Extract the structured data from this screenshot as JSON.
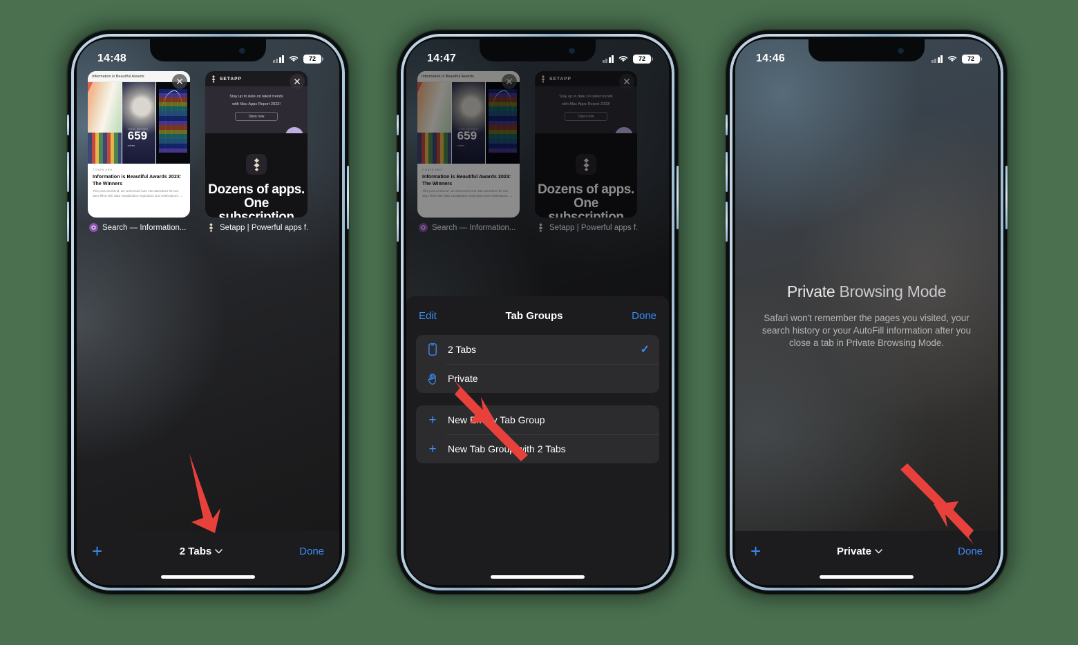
{
  "background_color": "#4a7050",
  "accent_color": "#3b8cf5",
  "arrow_color": "#e8413c",
  "phones": [
    {
      "id": "phone-tab-switcher",
      "status": {
        "time": "14:48",
        "battery": "72",
        "cellular_icon": "cellular-bars-icon",
        "wifi_icon": "wifi-icon",
        "battery_icon": "battery-icon"
      },
      "tabs": [
        {
          "title": "Search — Information...",
          "favicon": "information-is-beautiful-favicon",
          "close_label": "✕",
          "page": {
            "header": "Information is Beautiful Awards",
            "stat_number": "659",
            "stat_caption": "TOTAL ENTRIES",
            "stat_label": "entries",
            "ago": "7 DAYS AGO",
            "headline": "Information is Beautiful Awards 2023: The Winners",
            "body": "This post weekend, we welcomed over 150 attendees for two days filled with data visualization inspiration and celebrations.  →"
          }
        },
        {
          "title": "Setapp | Powerful apps f...",
          "favicon": "setapp-favicon",
          "close_label": "✕",
          "page": {
            "brand": "SETAPP",
            "promo_line1": "Stay up to date on latest trends",
            "promo_line2": "with Mac Apps Report 2023!",
            "promo_button": "Open now",
            "hero": "Dozens of apps. One subscription"
          }
        }
      ],
      "toolbar": {
        "new_tab_label": "+",
        "center_label": "2 Tabs",
        "chevron": "⌄",
        "done_label": "Done"
      },
      "arrow": {
        "name": "arrow-to-tab-group-selector",
        "direction": "down-right"
      }
    },
    {
      "id": "phone-tab-groups-sheet",
      "status": {
        "time": "14:47",
        "battery": "72"
      },
      "sheet": {
        "edit_label": "Edit",
        "title": "Tab Groups",
        "done_label": "Done",
        "groups": [
          {
            "rows": [
              {
                "icon": "iphone-icon",
                "label": "2 Tabs",
                "checked": true,
                "check_glyph": "✓"
              },
              {
                "icon": "hand-raised-icon",
                "label": "Private",
                "checked": false
              }
            ]
          },
          {
            "rows": [
              {
                "icon": "plus-icon",
                "label": "New Empty Tab Group"
              },
              {
                "icon": "plus-icon",
                "label": "New Tab Group with 2 Tabs"
              }
            ]
          }
        ]
      },
      "arrow": {
        "name": "arrow-to-private-row",
        "direction": "up-left"
      }
    },
    {
      "id": "phone-private-browsing",
      "status": {
        "time": "14:46",
        "battery": "72"
      },
      "private": {
        "title_prefix": "Private",
        "title_rest": " Browsing Mode",
        "description": "Safari won't remember the pages you visited, your search history or your AutoFill information after you close a tab in Private Browsing Mode."
      },
      "toolbar": {
        "new_tab_label": "+",
        "center_label": "Private",
        "chevron": "⌄",
        "done_label": "Done"
      },
      "arrow": {
        "name": "arrow-to-done-button",
        "direction": "down-right"
      }
    }
  ]
}
